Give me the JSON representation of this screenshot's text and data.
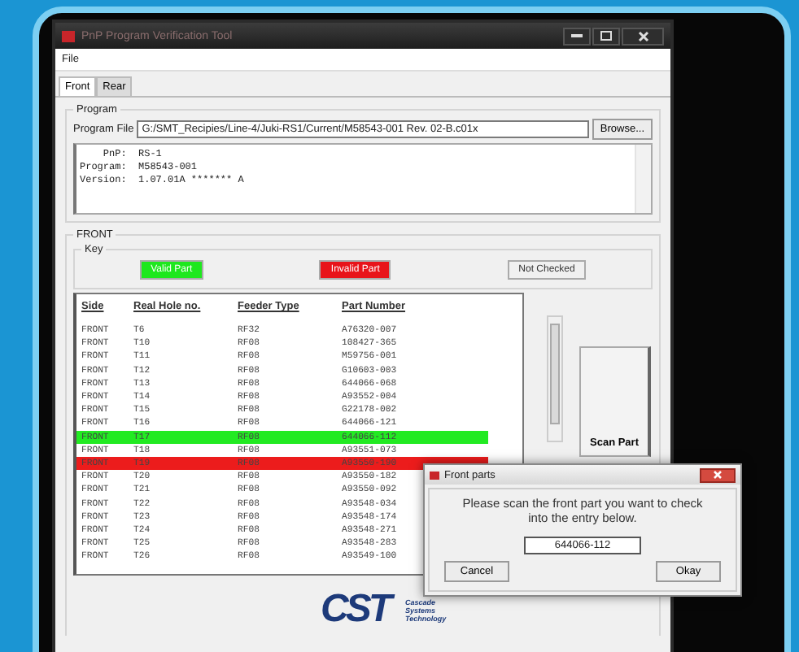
{
  "window": {
    "title": "PnP Program Verification Tool"
  },
  "menu": [
    "File"
  ],
  "tabs": [
    {
      "label": "Front",
      "selected": true
    },
    {
      "label": "Rear",
      "selected": false
    }
  ],
  "program": {
    "group_title": "Program",
    "file_label": "Program File",
    "file_path": "G:/SMT_Recipies/Line-4/Juki-RS1/Current/M58543-001 Rev. 02-B.c01x",
    "browse_button": "Browse...",
    "lines": [
      "    PnP:  RS-1",
      "Program:  M58543-001",
      "Version:  1.07.01A ******* A"
    ]
  },
  "front": {
    "group_title": "FRONT",
    "key_title": "Key",
    "key": [
      {
        "label": "Valid Part",
        "kind": "valid"
      },
      {
        "label": "Invalid Part",
        "kind": "invalid"
      },
      {
        "label": "Not Checked",
        "kind": "unchecked"
      }
    ]
  },
  "table": {
    "columns": [
      "Side",
      "Real Hole no.",
      "Feeder Type",
      "Part Number"
    ],
    "rows": [
      {
        "cells": [
          "FRONT",
          "T6",
          "RF32",
          "A76320-007"
        ],
        "kind": "unchecked"
      },
      {
        "cells": [
          "FRONT",
          "T10",
          "RF08",
          "108427-365"
        ],
        "kind": "unchecked"
      },
      {
        "cells": [
          "FRONT",
          "T11",
          "RF08",
          "M59756-001"
        ],
        "kind": "unchecked"
      },
      {
        "cells": [
          "FRONT",
          "T12",
          "RF08",
          "G10603-003"
        ],
        "kind": "unchecked"
      },
      {
        "cells": [
          "FRONT",
          "T13",
          "RF08",
          "644066-068"
        ],
        "kind": "unchecked"
      },
      {
        "cells": [
          "FRONT",
          "T14",
          "RF08",
          "A93552-004"
        ],
        "kind": "unchecked"
      },
      {
        "cells": [
          "FRONT",
          "T15",
          "RF08",
          "G22178-002"
        ],
        "kind": "unchecked"
      },
      {
        "cells": [
          "FRONT",
          "T16",
          "RF08",
          "644066-121"
        ],
        "kind": "unchecked"
      },
      {
        "cells": [
          "FRONT",
          "T17",
          "RF08",
          "644066-112"
        ],
        "kind": "valid"
      },
      {
        "cells": [
          "FRONT",
          "T18",
          "RF08",
          "A93551-073"
        ],
        "kind": "unchecked"
      },
      {
        "cells": [
          "FRONT",
          "T19",
          "RF08",
          "A93550-190"
        ],
        "kind": "invalid"
      },
      {
        "cells": [
          "FRONT",
          "T20",
          "RF08",
          "A93550-182"
        ],
        "kind": "unchecked"
      },
      {
        "cells": [
          "FRONT",
          "T21",
          "RF08",
          "A93550-092"
        ],
        "kind": "unchecked"
      },
      {
        "cells": [
          "FRONT",
          "T22",
          "RF08",
          "A93548-034"
        ],
        "kind": "unchecked"
      },
      {
        "cells": [
          "FRONT",
          "T23",
          "RF08",
          "A93548-174"
        ],
        "kind": "unchecked"
      },
      {
        "cells": [
          "FRONT",
          "T24",
          "RF08",
          "A93548-271"
        ],
        "kind": "unchecked"
      },
      {
        "cells": [
          "FRONT",
          "T25",
          "RF08",
          "A93548-283"
        ],
        "kind": "unchecked"
      },
      {
        "cells": [
          "FRONT",
          "T26",
          "RF08",
          "A93549-100"
        ],
        "kind": "unchecked"
      }
    ]
  },
  "scan_button": "Scan Part",
  "logo": {
    "mark": "CST",
    "lines": [
      "Cascade",
      "Systems",
      "Technology"
    ]
  },
  "dialog": {
    "title": "Front parts",
    "message": "Please scan the front part you want to check into the entry below.",
    "value": "644066-112",
    "buttons": [
      "Cancel",
      "Okay"
    ]
  }
}
